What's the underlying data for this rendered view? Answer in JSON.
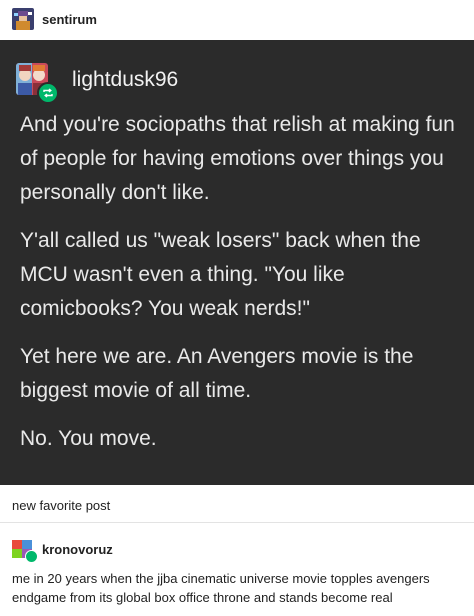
{
  "header": {
    "username": "sentirum",
    "avatar_icon": "pixel-character-avatar"
  },
  "original_post": {
    "username": "lightdusk96",
    "avatar_icon": "anime-characters-avatar",
    "badge_icon": "reblog-icon",
    "badge_color": "#00b86b",
    "paragraphs": [
      "And you're sociopaths that relish at making fun of people for having emotions over things you personally don't like.",
      "Y'all called us \"weak losers\" back when the MCU wasn't even a thing. \"You like comicbooks? You weak nerds!\"",
      "Yet here we are. An Avengers movie is the biggest movie of all time.",
      "No. You move."
    ]
  },
  "caption": "new favorite post",
  "reply": {
    "username": "kronovoruz",
    "avatar_icon": "pixel-art-avatar",
    "badge_icon": "reblog-icon",
    "text": "me in 20 years when the jjba cinematic universe movie topples avengers endgame from its global box office throne and stands become real"
  }
}
